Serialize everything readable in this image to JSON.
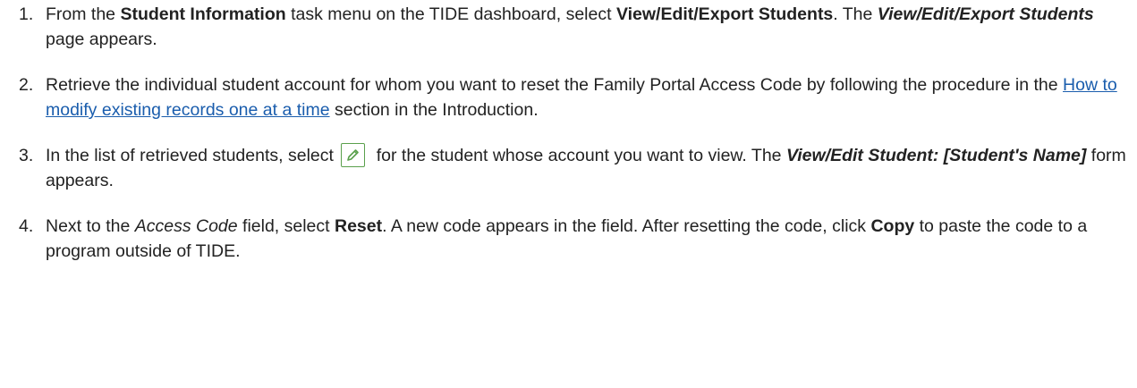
{
  "steps": [
    {
      "number": "1.",
      "p1": "From the ",
      "b1": "Student Information",
      "p2": " task menu on the TIDE dashboard, select ",
      "b2": "View/Edit/Export Students",
      "p3": ". The ",
      "bi1": "View/Edit/Export Students",
      "p4": " page appears."
    },
    {
      "number": "2.",
      "p1": "Retrieve the individual student account for whom you want to reset the Family Portal Access Code by following the procedure in the ",
      "link": "How to modify existing records one at a time",
      "p2": " section in the Introduction."
    },
    {
      "number": "3.",
      "p1": "In the list of retrieved students, select ",
      "icon": "pencil-edit-icon",
      "p2": " for the student whose account you want to view. The ",
      "bi1": "View/Edit Student: [Student's Name]",
      "p3": " form appears."
    },
    {
      "number": "4.",
      "p1": "Next to the ",
      "i1": "Access Code",
      "p2": " field, select ",
      "b1": "Reset",
      "p3": ". A new code appears in the field. After resetting the code, click ",
      "b2": "Copy",
      "p4": " to paste the code to a program outside of TIDE."
    }
  ],
  "colors": {
    "text": "#222222",
    "link": "#1a5dad",
    "icon_border": "#5aa04c",
    "icon_pencil": "#5aa04c"
  }
}
